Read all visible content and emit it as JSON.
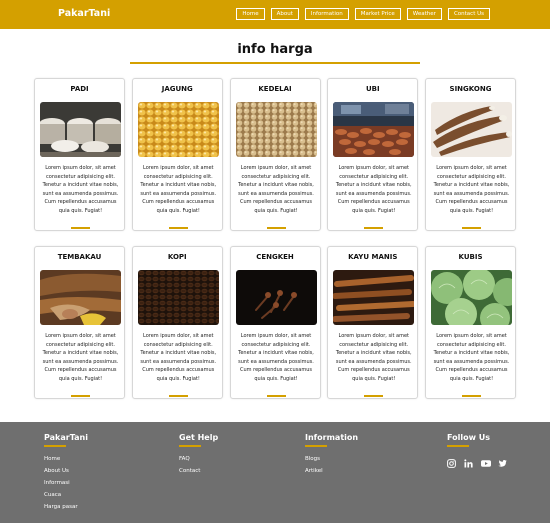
{
  "header": {
    "brand": "PakarTani",
    "nav": [
      "Home",
      "About",
      "Information",
      "Market Price",
      "Weather",
      "Contact Us"
    ]
  },
  "page": {
    "title": "info harga"
  },
  "cards": [
    {
      "title": "PADI",
      "text": "Lorem ipsum dolor, sit amet consectetur adipisicing elit. Tenetur a incidunt vitae nobis, sunt ea assumenda possimus. Cum repellendus accusamus quia quis. Fugiat!",
      "image": "rice-sacks-image"
    },
    {
      "title": "JAGUNG",
      "text": "Lorem ipsum dolor, sit amet consectetur adipisicing elit. Tenetur a incidunt vitae nobis, sunt ea assumenda possimus. Cum repellendus accusamus quia quis. Fugiat!",
      "image": "corn-kernels-image"
    },
    {
      "title": "KEDELAI",
      "text": "Lorem ipsum dolor, sit amet consectetur adipisicing elit. Tenetur a incidunt vitae nobis, sunt ea assumenda possimus. Cum repellendus accusamus quia quis. Fugiat!",
      "image": "soybeans-image"
    },
    {
      "title": "UBI",
      "text": "Lorem ipsum dolor, sit amet consectetur adipisicing elit. Tenetur a incidunt vitae nobis, sunt ea assumenda possimus. Cum repellendus accusamus quia quis. Fugiat!",
      "image": "sweet-potato-market-image"
    },
    {
      "title": "SINGKONG",
      "text": "Lorem ipsum dolor, sit amet consectetur adipisicing elit. Tenetur a incidunt vitae nobis, sunt ea assumenda possimus. Cum repellendus accusamus quia quis. Fugiat!",
      "image": "cassava-image"
    },
    {
      "title": "TEMBAKAU",
      "text": "Lorem ipsum dolor, sit amet consectetur adipisicing elit. Tenetur a incidunt vitae nobis, sunt ea assumenda possimus. Cum repellendus accusamus quia quis. Fugiat!",
      "image": "tobacco-image"
    },
    {
      "title": "KOPI",
      "text": "Lorem ipsum dolor, sit amet consectetur adipisicing elit. Tenetur a incidunt vitae nobis, sunt ea assumenda possimus. Cum repellendus accusamus quia quis. Fugiat!",
      "image": "coffee-beans-image"
    },
    {
      "title": "CENGKEH",
      "text": "Lorem ipsum dolor, sit amet consectetur adipisicing elit. Tenetur a incidunt vitae nobis, sunt ea assumenda possimus. Cum repellendus accusamus quia quis. Fugiat!",
      "image": "cloves-image"
    },
    {
      "title": "KAYU MANIS",
      "text": "Lorem ipsum dolor, sit amet consectetur adipisicing elit. Tenetur a incidunt vitae nobis, sunt ea assumenda possimus. Cum repellendus accusamus quia quis. Fugiat!",
      "image": "cinnamon-image"
    },
    {
      "title": "KUBIS",
      "text": "Lorem ipsum dolor, sit amet consectetur adipisicing elit. Tenetur a incidunt vitae nobis, sunt ea assumenda possimus. Cum repellendus accusamus quia quis. Fugiat!",
      "image": "cabbage-image"
    }
  ],
  "footer": {
    "brand": "PakarTani",
    "brand_links": [
      "Home",
      "About Us",
      "Informasi",
      "Cuaca",
      "Harga pasar"
    ],
    "help_head": "Get Help",
    "help_links": [
      "FAQ",
      "Contact"
    ],
    "info_head": "Information",
    "info_links": [
      "Blogs",
      "Artikel"
    ],
    "follow_head": "Follow Us",
    "social": [
      "instagram-icon",
      "linkedin-icon",
      "youtube-icon",
      "twitter-icon"
    ]
  },
  "colors": {
    "accent": "#d4a000",
    "footer_bg": "#6f6f6f"
  }
}
